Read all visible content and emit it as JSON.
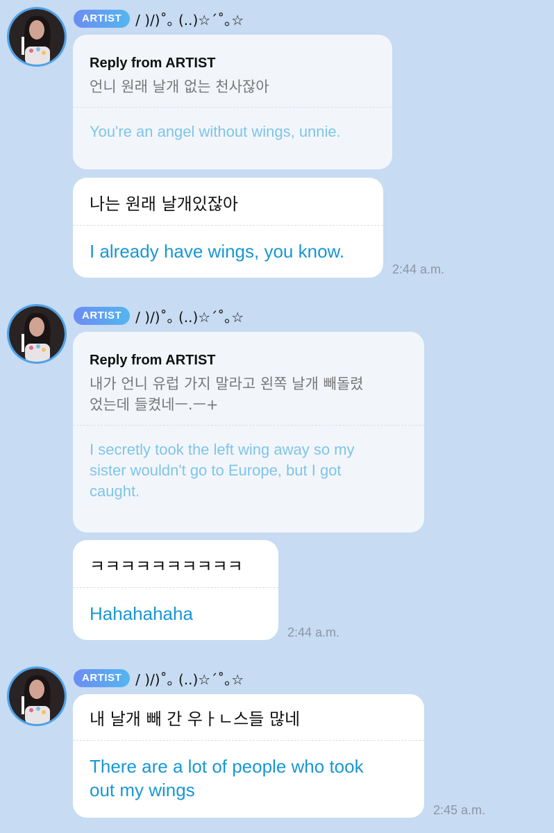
{
  "messages": [
    {
      "badge": "ARTIST",
      "nickname": "/ )/)˚｡ (..)☆´˚｡☆",
      "reply": {
        "header": "Reply from ARTIST",
        "korean": "언니 원래 날개 없는 천사잖아",
        "english": "You're an angel without wings, unnie."
      },
      "bubble": {
        "korean": "나는 원래 날개있잖아",
        "english": "I already have wings, you know."
      },
      "time": "2:44 a.m."
    },
    {
      "badge": "ARTIST",
      "nickname": "/ )/)˚｡ (..)☆´˚｡☆",
      "reply": {
        "header": "Reply from ARTIST",
        "korean_line1": "내가 언니 유럽 가지 말라고 왼쪽 날개 빼돌렸",
        "korean_line2": "었는데 들켰네ㅡ.ㅡ+",
        "english_line1": "I secretly took the left wing away so my",
        "english_line2": "sister wouldn't go to Europe, but I got",
        "english_line3": "caught."
      },
      "bubble": {
        "korean": "ㅋㅋㅋㅋㅋㅋㅋㅋㅋㅋ",
        "english": "Hahahahaha"
      },
      "time": "2:44 a.m."
    },
    {
      "badge": "ARTIST",
      "nickname": "/ )/)˚｡ (..)☆´˚｡☆",
      "bubble": {
        "korean": "내 날개 빼 간 우ㅏㄴ스들 많네",
        "english_line1": "There are a lot of people who took",
        "english_line2": "out my wings"
      },
      "time": "2:45 a.m."
    }
  ]
}
